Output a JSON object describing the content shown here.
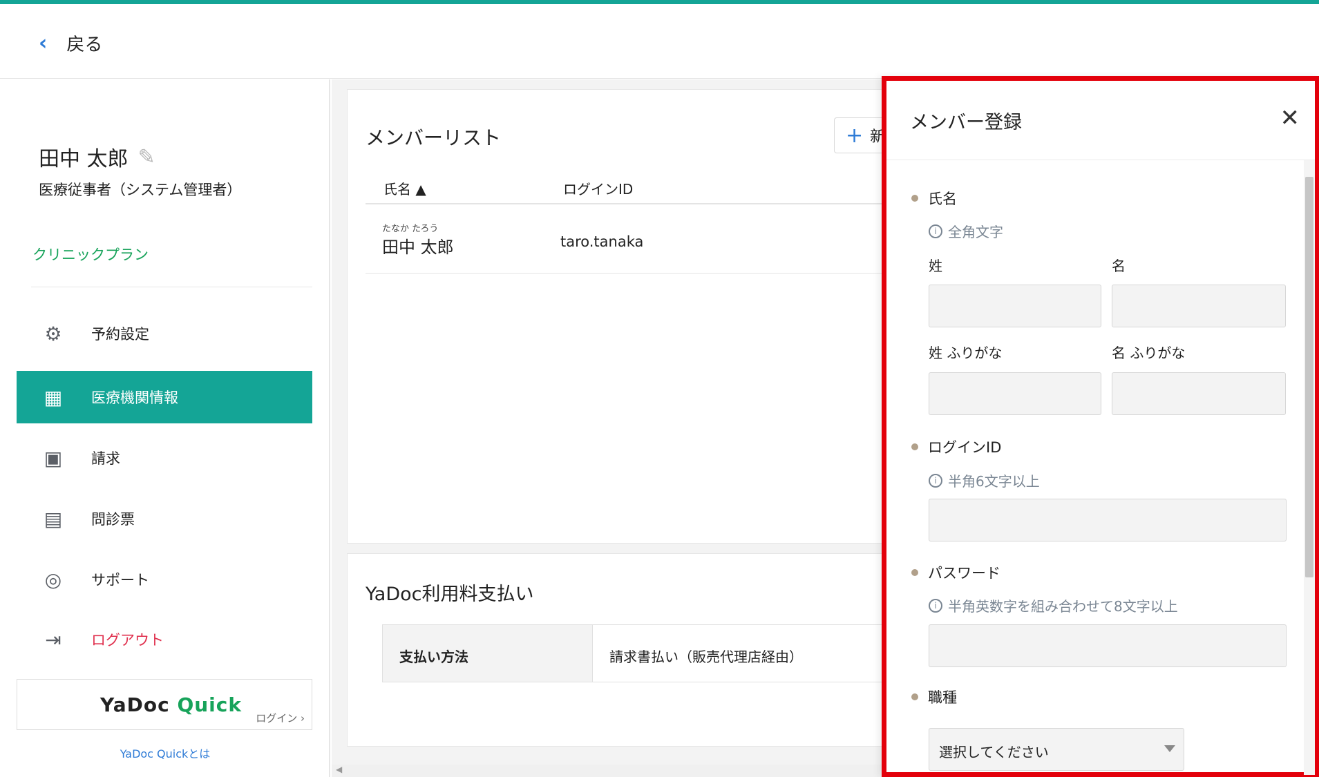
{
  "header": {
    "back_label": "戻る"
  },
  "sidebar": {
    "user_name": "田中 太郎",
    "user_role": "医療従事者（システム管理者）",
    "plan": "クリニックプラン",
    "items": [
      {
        "label": "予約設定",
        "icon": "gear-icon"
      },
      {
        "label": "医療機関情報",
        "icon": "building-icon"
      },
      {
        "label": "請求",
        "icon": "billing-icon"
      },
      {
        "label": "問診票",
        "icon": "clipboard-icon"
      },
      {
        "label": "サポート",
        "icon": "lifebuoy-icon"
      },
      {
        "label": "ログアウト",
        "icon": "logout-icon"
      }
    ],
    "quick": {
      "logo_left": "YaDoc",
      "logo_right": "Quick",
      "login": "ログイン ›",
      "about": "YaDoc Quickとは"
    }
  },
  "members": {
    "title": "メンバーリスト",
    "add_label": "新",
    "columns": [
      "氏名 ▲",
      "ログインID"
    ],
    "rows": [
      {
        "ruby": "たなか たろう",
        "name": "田中 太郎",
        "login_id": "taro.tanaka"
      }
    ]
  },
  "payment": {
    "title": "YaDoc利用料支払い",
    "label": "支払い方法",
    "value": "請求書払い（販売代理店経由）"
  },
  "panel": {
    "title": "メンバー登録",
    "close": "✕",
    "name_section": "氏名",
    "name_hint": "全角文字",
    "last_name": "姓",
    "first_name": "名",
    "last_kana": "姓 ふりがな",
    "first_kana": "名 ふりがな",
    "login_section": "ログインID",
    "login_hint": "半角6文字以上",
    "password_section": "パスワード",
    "password_hint": "半角英数字を組み合わせて8文字以上",
    "job_section": "職種",
    "job_placeholder": "選択してください"
  },
  "colors": {
    "accent": "#14a596",
    "highlight": "#e3000b",
    "logout": "#e0304e",
    "plan": "#17a35a"
  }
}
